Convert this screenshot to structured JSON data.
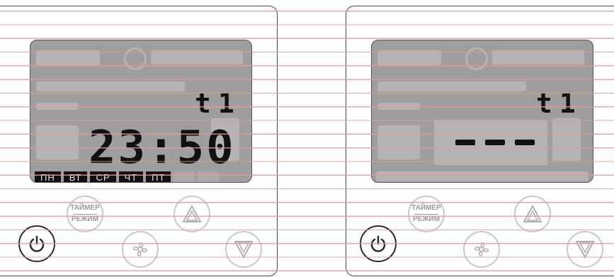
{
  "left_panel": {
    "mode_indicator": "t1",
    "time": "23:50",
    "days": [
      "ПН",
      "ВТ",
      "СР",
      "ЧТ",
      "ПТ"
    ],
    "timer_button": {
      "line1": "ТАЙМЕР",
      "line2": "РЕЖИМ"
    }
  },
  "right_panel": {
    "mode_indicator": "t1",
    "timer_button": {
      "line1": "ТАЙМЕР",
      "line2": "РЕЖИМ"
    }
  },
  "colors": {
    "lcd_background": "#9e9e9e",
    "segment_active": "#111111",
    "button_outline": "#c8c8c8",
    "guide_lines": "#e89696"
  }
}
